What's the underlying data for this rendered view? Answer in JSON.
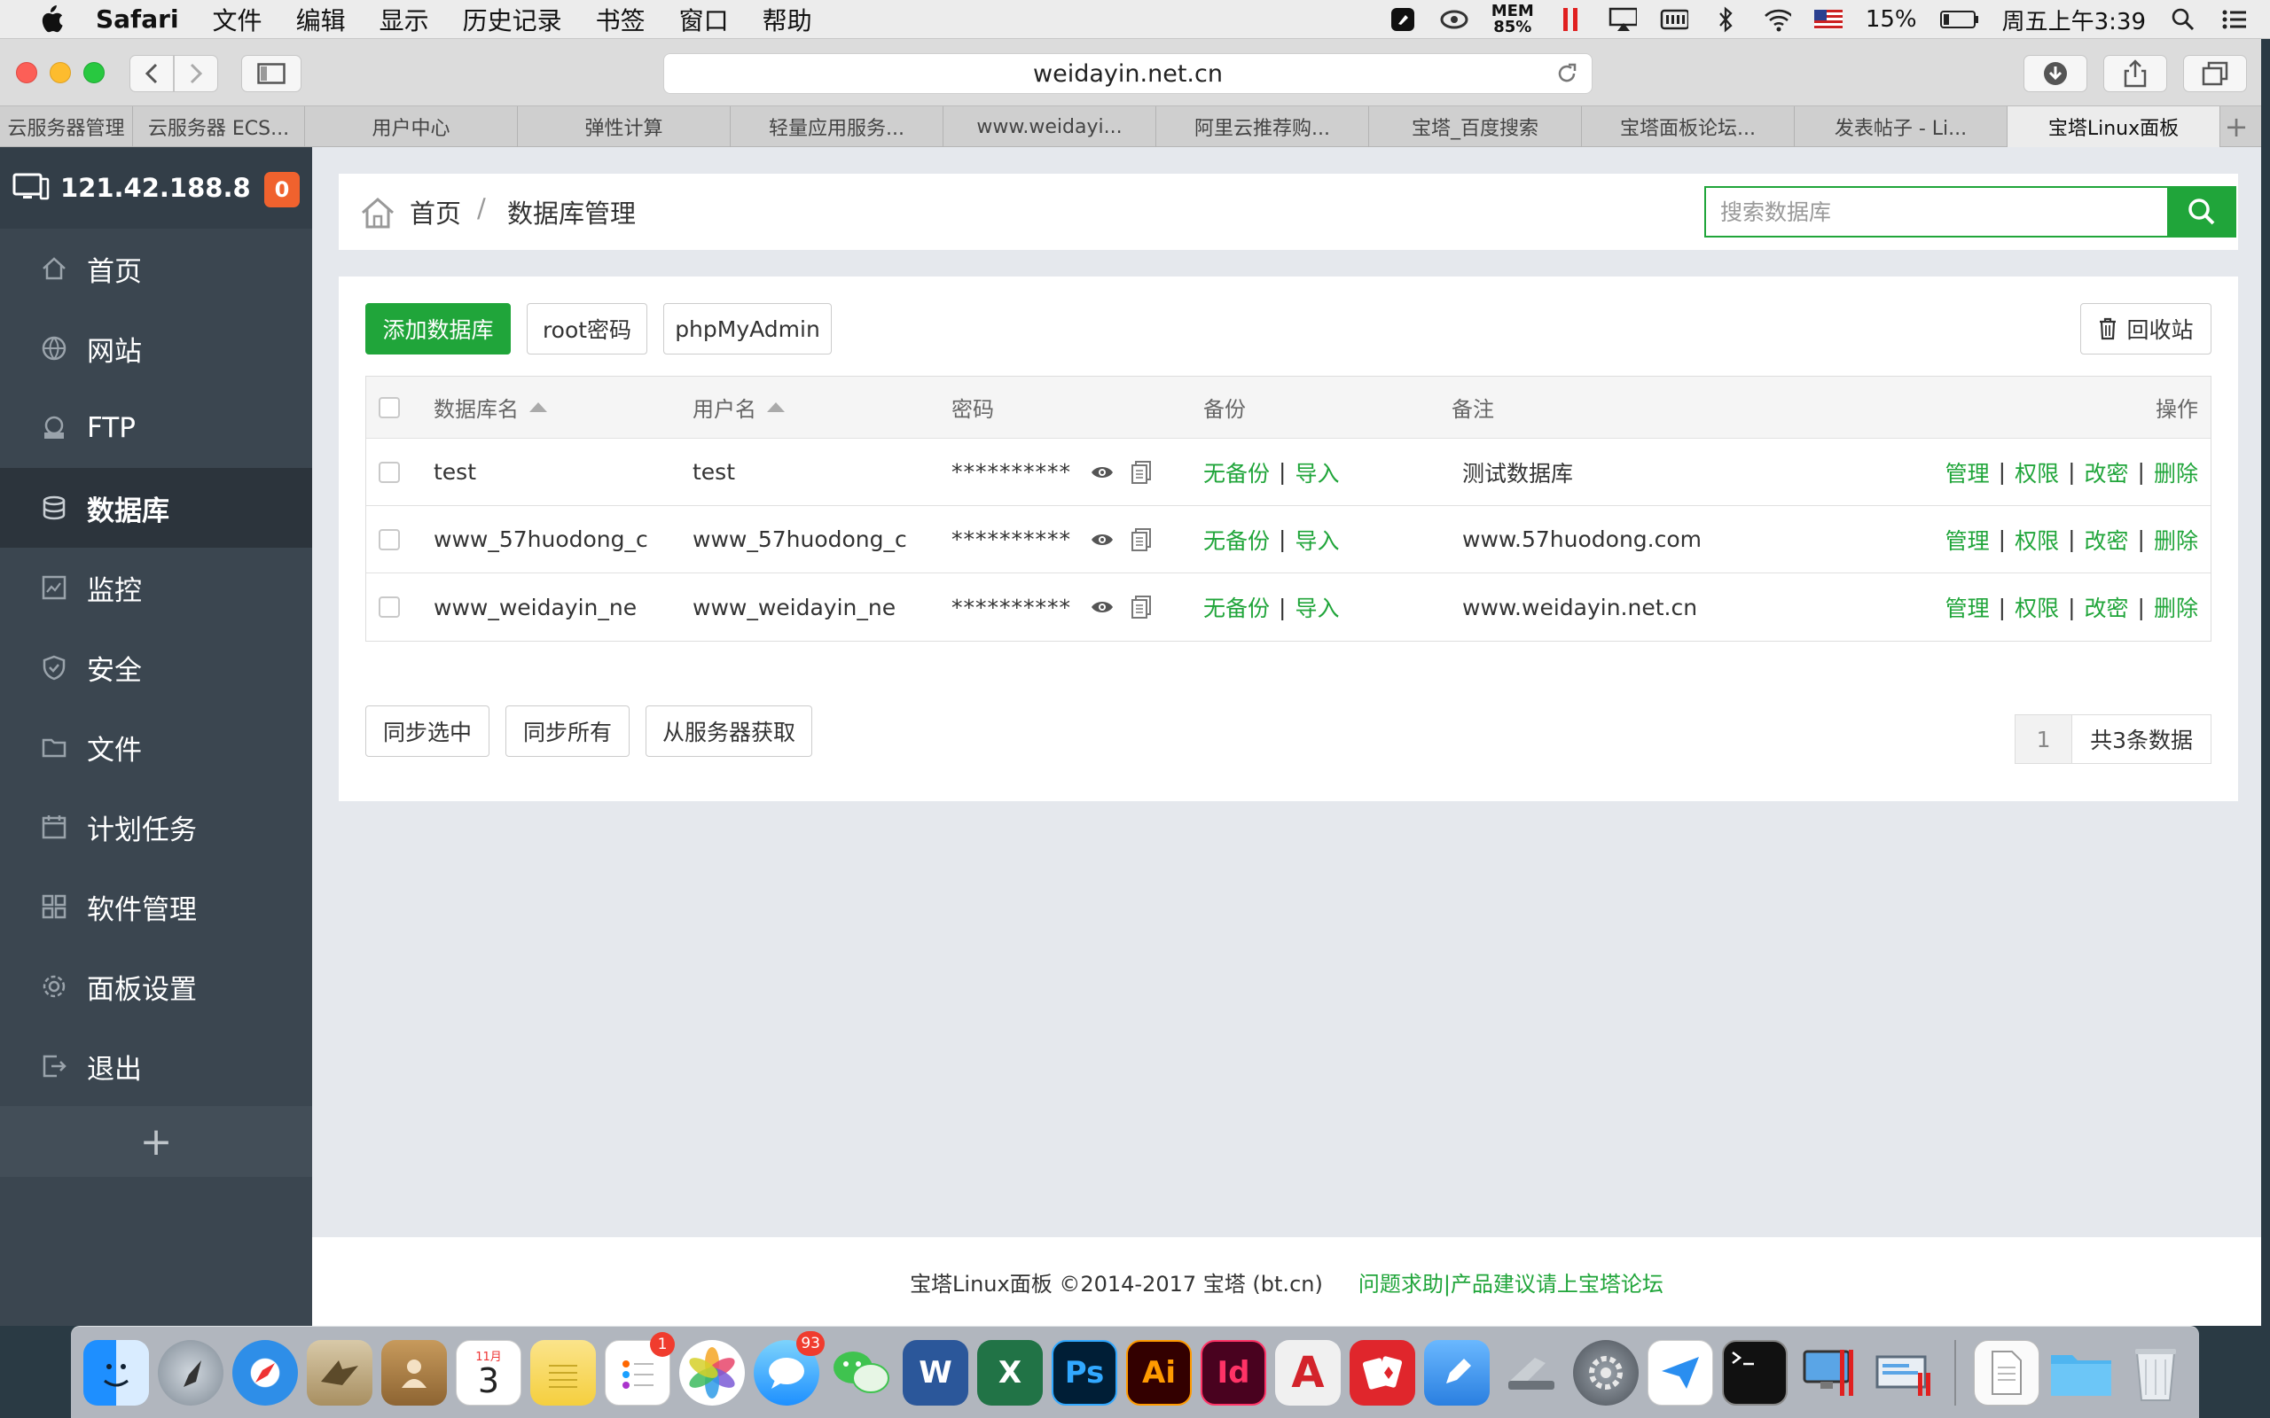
{
  "menubar": {
    "items": [
      "Safari",
      "文件",
      "编辑",
      "显示",
      "历史记录",
      "书签",
      "窗口",
      "帮助"
    ],
    "mem_label": "MEM",
    "mem_value": "85%",
    "battery": "15%",
    "clock": "周五上午3:39"
  },
  "browser": {
    "url": "weidayin.net.cn",
    "tabs": [
      "云服务器管理",
      "云服务器 ECS...",
      "用户中心",
      "弹性计算",
      "轻量应用服务...",
      "www.weidayi...",
      "阿里云推荐购...",
      "宝塔_百度搜索",
      "宝塔面板论坛...",
      "发表帖子 - Li...",
      "宝塔Linux面板"
    ],
    "active_tab": 10
  },
  "sidebar": {
    "server_ip": "121.42.188.8",
    "badge": "0",
    "items": [
      {
        "label": "首页",
        "icon": "home-icon"
      },
      {
        "label": "网站",
        "icon": "globe-icon"
      },
      {
        "label": "FTP",
        "icon": "ftp-icon"
      },
      {
        "label": "数据库",
        "icon": "database-icon"
      },
      {
        "label": "监控",
        "icon": "monitor-icon"
      },
      {
        "label": "安全",
        "icon": "shield-icon"
      },
      {
        "label": "文件",
        "icon": "folder-icon"
      },
      {
        "label": "计划任务",
        "icon": "calendar-icon"
      },
      {
        "label": "软件管理",
        "icon": "grid-icon"
      },
      {
        "label": "面板设置",
        "icon": "gear-icon"
      },
      {
        "label": "退出",
        "icon": "logout-icon"
      }
    ],
    "active_index": 3,
    "add_label": "+"
  },
  "breadcrumb": {
    "home": "首页",
    "sep": "/",
    "current": "数据库管理"
  },
  "search": {
    "placeholder": "搜索数据库"
  },
  "toolbar": {
    "add_db": "添加数据库",
    "root_pwd": "root密码",
    "phpmyadmin": "phpMyAdmin",
    "recycle": "回收站"
  },
  "table": {
    "headers": {
      "name": "数据库名",
      "user": "用户名",
      "password": "密码",
      "backup": "备份",
      "note": "备注",
      "ops": "操作"
    },
    "rows": [
      {
        "name": "test",
        "user": "test",
        "password": "**********",
        "backup": "无备份",
        "import": "导入",
        "note": "测试数据库"
      },
      {
        "name": "www_57huodong_c",
        "user": "www_57huodong_c",
        "password": "**********",
        "backup": "无备份",
        "import": "导入",
        "note": "www.57huodong.com"
      },
      {
        "name": "www_weidayin_ne",
        "user": "www_weidayin_ne",
        "password": "**********",
        "backup": "无备份",
        "import": "导入",
        "note": "www.weidayin.net.cn"
      }
    ],
    "ops": {
      "manage": "管理",
      "perm": "权限",
      "chpwd": "改密",
      "delete": "删除"
    },
    "op_sep": "|"
  },
  "bottom_buttons": {
    "sync_selected": "同步选中",
    "sync_all": "同步所有",
    "fetch_server": "从服务器获取"
  },
  "pager": {
    "page": "1",
    "total": "共3条数据"
  },
  "footer": {
    "copyright": "宝塔Linux面板 ©2014-2017 宝塔 (bt.cn)",
    "link": "问题求助|产品建议请上宝塔论坛"
  },
  "dock": {
    "calendar_month": "11月",
    "calendar_day": "3",
    "reminders_badge": "1",
    "messages_badge": "93",
    "word": "W",
    "excel": "X",
    "photoshop": "Ps",
    "illustrator": "Ai",
    "indesign": "Id",
    "autocad": "A"
  },
  "colors": {
    "accent": "#20a53a",
    "sidebar": "#3b4650",
    "badge": "#f0622e"
  }
}
